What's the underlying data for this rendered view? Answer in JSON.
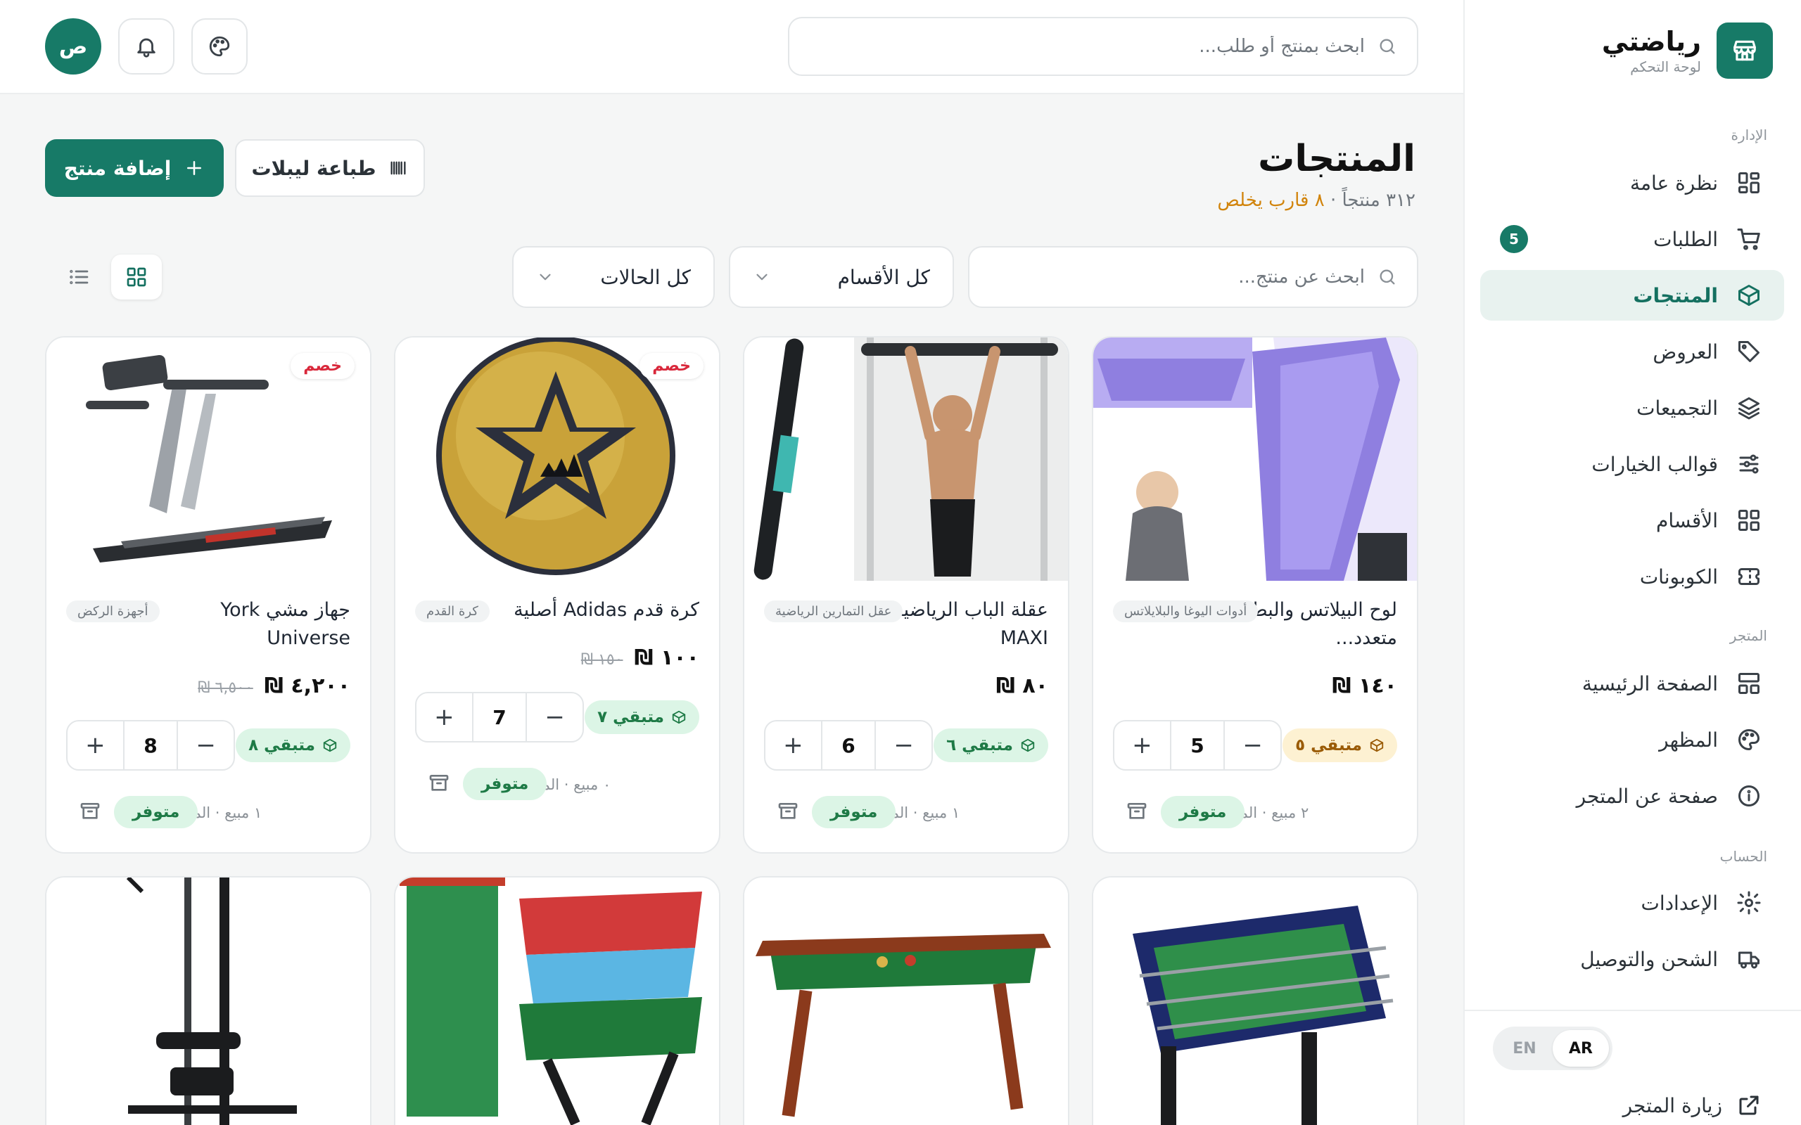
{
  "brand": {
    "name": "رياضتي",
    "subtitle": "لوحة التحكم"
  },
  "sidebar": {
    "sections": [
      {
        "label": "الإدارة"
      },
      {
        "label": "المتجر"
      },
      {
        "label": "الحساب"
      }
    ],
    "items": [
      {
        "label": "نظرة عامة",
        "icon": "dashboard-icon"
      },
      {
        "label": "الطلبات",
        "icon": "cart-icon",
        "badge": "5"
      },
      {
        "label": "المنتجات",
        "icon": "box-icon",
        "active": true
      },
      {
        "label": "العروض",
        "icon": "tag-icon"
      },
      {
        "label": "التجميعات",
        "icon": "layers-icon"
      },
      {
        "label": "قوالب الخيارات",
        "icon": "sliders-icon"
      },
      {
        "label": "الأقسام",
        "icon": "grid-icon"
      },
      {
        "label": "الكوبونات",
        "icon": "ticket-icon"
      },
      {
        "label": "الصفحة الرئيسية",
        "icon": "layout-icon"
      },
      {
        "label": "المظهر",
        "icon": "palette-icon"
      },
      {
        "label": "صفحة عن المتجر",
        "icon": "info-icon"
      },
      {
        "label": "الإعدادات",
        "icon": "gear-icon"
      },
      {
        "label": "الشحن والتوصيل",
        "icon": "truck-icon"
      }
    ],
    "language": {
      "en": "EN",
      "ar": "AR",
      "selected": "AR"
    },
    "visit_store": "زيارة المتجر"
  },
  "topbar": {
    "search_placeholder": "ابحث بمنتج أو طلب...",
    "avatar_initial": "ص"
  },
  "page": {
    "title": "المنتجات",
    "subtitle_count": "٣١٢ منتجاً ·",
    "subtitle_warning": "٨ قارب يخلص",
    "add_button": "إضافة منتج",
    "print_button": "طباعة ليبلات",
    "search_placeholder": "ابحث عن منتج...",
    "category_filter": "كل الأقسام",
    "status_filter": "كل الحالات",
    "view_mode": "grid"
  },
  "products": [
    {
      "name": "لوح البيلاتس والبطن متعدد...",
      "category": "أدوات اليوغا والبلايلاتس",
      "price": "١٤٠ ₪",
      "old_price": "",
      "sale": false,
      "qty": "5",
      "stock": "متبقي ٥",
      "stock_level": "low",
      "meta": "٢ مبيع · المتبقي ٥",
      "status": "متوفر"
    },
    {
      "name": "عقلة الباب الرياضية MAXI",
      "category": "عقل التمارين الرياضية",
      "price": "٨٠ ₪",
      "old_price": "",
      "sale": false,
      "qty": "6",
      "stock": "متبقي ٦",
      "stock_level": "ok",
      "meta": "١ مبيع · المتبقي ٦",
      "status": "متوفر"
    },
    {
      "name": "كرة قدم Adidas أصلية",
      "category": "كرة القدم",
      "price": "١٠٠ ₪",
      "old_price": "١٥٠ ₪",
      "sale": true,
      "sale_label": "خصم",
      "qty": "7",
      "stock": "متبقي ٧",
      "stock_level": "ok",
      "meta": "٠ مبيع · المتبقي ٧",
      "status": "متوفر"
    },
    {
      "name": "جهاز مشي York Universe",
      "category": "أجهزة الركض",
      "price": "٤,٢٠٠ ₪",
      "old_price": "٦,٥٠٠ ₪",
      "sale": true,
      "sale_label": "خصم",
      "qty": "8",
      "stock": "متبقي ٨",
      "stock_level": "ok",
      "meta": "١ مبيع · المتبقي ٨",
      "status": "متوفر"
    }
  ],
  "colors": {
    "brand": "#177a67",
    "active_bg": "#e8f2ef",
    "sale": "#d9283b",
    "warning": "#d1840c"
  }
}
